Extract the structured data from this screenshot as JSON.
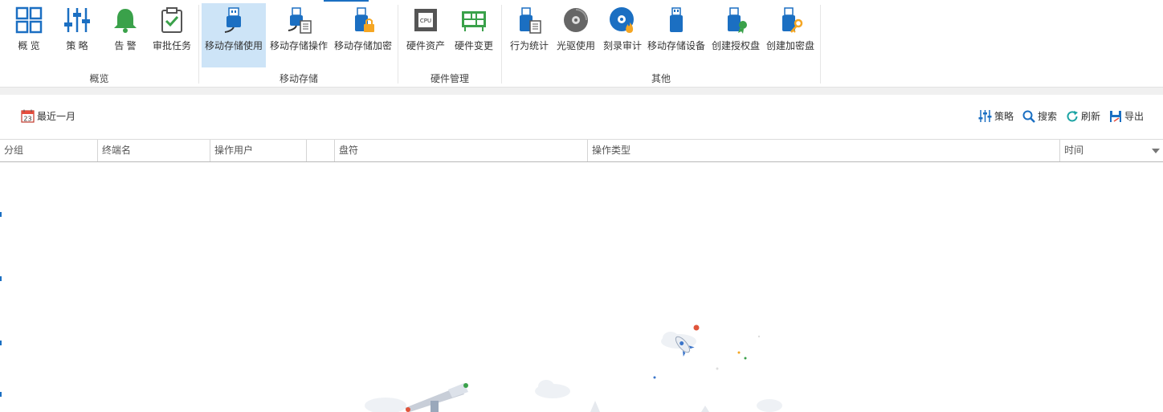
{
  "ribbon": {
    "groups": [
      {
        "label": "概览",
        "buttons": [
          {
            "label": "概 览",
            "icon": "overview-grid-icon"
          },
          {
            "label": "策 略",
            "icon": "policy-sliders-icon"
          },
          {
            "label": "告 警",
            "icon": "alarm-bell-icon"
          },
          {
            "label": "审批任务",
            "icon": "approval-task-icon"
          }
        ]
      },
      {
        "label": "移动存储",
        "buttons": [
          {
            "label": "移动存储使用",
            "icon": "usb-usage-icon",
            "active": true
          },
          {
            "label": "移动存储操作",
            "icon": "usb-operation-icon"
          },
          {
            "label": "移动存储加密",
            "icon": "usb-encrypt-icon"
          }
        ]
      },
      {
        "label": "硬件管理",
        "buttons": [
          {
            "label": "硬件资产",
            "icon": "cpu-icon"
          },
          {
            "label": "硬件变更",
            "icon": "hardware-change-icon"
          }
        ]
      },
      {
        "label": "其他",
        "buttons": [
          {
            "label": "行为统计",
            "icon": "behavior-stats-icon"
          },
          {
            "label": "光驱使用",
            "icon": "cd-drive-icon"
          },
          {
            "label": "刻录审计",
            "icon": "burn-audit-icon"
          },
          {
            "label": "移动存储设备",
            "icon": "usb-device-icon"
          },
          {
            "label": "创建授权盘",
            "icon": "authorized-disk-icon"
          },
          {
            "label": "创建加密盘",
            "icon": "encrypted-disk-icon"
          }
        ]
      }
    ]
  },
  "toolbar": {
    "date_range": "最近一月",
    "calendar_day": "23",
    "policy": "策略",
    "search": "搜索",
    "refresh": "刷新",
    "export": "导出"
  },
  "table": {
    "columns": [
      "分组",
      "终端名",
      "操作用户",
      "",
      "盘符",
      "操作类型",
      "时间"
    ]
  },
  "colors": {
    "accent": "#1b6fc2",
    "active_bg": "#cde4f7",
    "icon_green": "#3aa14a",
    "icon_orange": "#f5a623"
  }
}
